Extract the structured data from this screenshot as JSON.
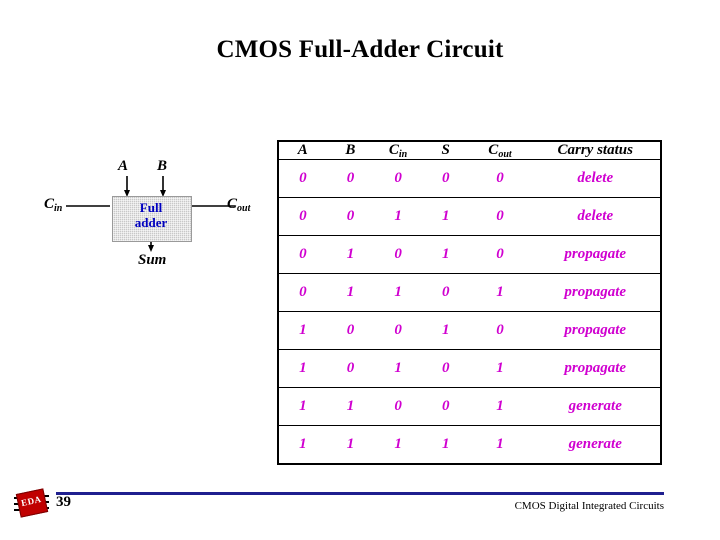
{
  "slide": {
    "title": "CMOS Full-Adder Circuit"
  },
  "diagram": {
    "block_label_line1": "Full",
    "block_label_line2": "adder",
    "input_a": "A",
    "input_b": "B",
    "input_cin_main": "C",
    "input_cin_sub": "in",
    "output_cout_main": "C",
    "output_cout_sub": "out",
    "output_sum": "Sum"
  },
  "table": {
    "headers": [
      {
        "main": "A",
        "sub": ""
      },
      {
        "main": "B",
        "sub": ""
      },
      {
        "main": "C",
        "sub": "in"
      },
      {
        "main": "S",
        "sub": ""
      },
      {
        "main": "C",
        "sub": "out"
      },
      {
        "main": "Carry status",
        "sub": ""
      }
    ],
    "rows": [
      {
        "a": "0",
        "b": "0",
        "cin": "0",
        "s": "0",
        "cout": "0",
        "status": "delete"
      },
      {
        "a": "0",
        "b": "0",
        "cin": "1",
        "s": "1",
        "cout": "0",
        "status": "delete"
      },
      {
        "a": "0",
        "b": "1",
        "cin": "0",
        "s": "1",
        "cout": "0",
        "status": "propagate"
      },
      {
        "a": "0",
        "b": "1",
        "cin": "1",
        "s": "0",
        "cout": "1",
        "status": "propagate"
      },
      {
        "a": "1",
        "b": "0",
        "cin": "0",
        "s": "1",
        "cout": "0",
        "status": "propagate"
      },
      {
        "a": "1",
        "b": "0",
        "cin": "1",
        "s": "0",
        "cout": "1",
        "status": "propagate"
      },
      {
        "a": "1",
        "b": "1",
        "cin": "0",
        "s": "0",
        "cout": "1",
        "status": "generate"
      },
      {
        "a": "1",
        "b": "1",
        "cin": "1",
        "s": "1",
        "cout": "1",
        "status": "generate"
      }
    ]
  },
  "footer": {
    "page_number": "39",
    "course_text": "CMOS Digital Integrated Circuits",
    "logo_text": "EDA"
  },
  "colors": {
    "value_text": "#d000d0",
    "block_label": "#0000c0",
    "footer_rule": "#1f1f8f",
    "logo": "#c00000"
  }
}
